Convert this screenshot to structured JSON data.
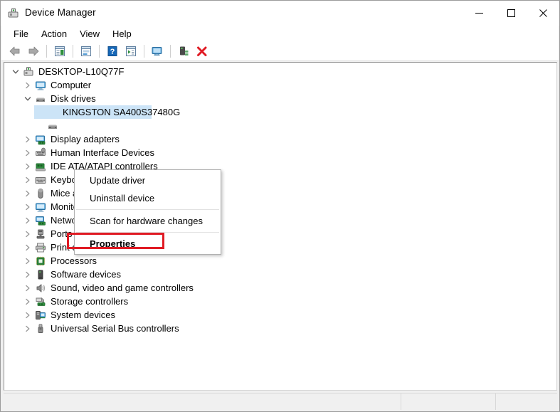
{
  "window": {
    "title": "Device Manager",
    "icon": "device-manager-icon",
    "controls": {
      "minimize": "—",
      "maximize": "□",
      "close": "✕"
    }
  },
  "menubar": {
    "items": [
      {
        "label": "File"
      },
      {
        "label": "Action"
      },
      {
        "label": "View"
      },
      {
        "label": "Help"
      }
    ]
  },
  "toolbar": {
    "buttons": [
      {
        "name": "back-icon",
        "title": "Back"
      },
      {
        "name": "forward-icon",
        "title": "Forward"
      },
      {
        "name": "separator",
        "title": ""
      },
      {
        "name": "show-hide-console-tree-icon",
        "title": "Show/Hide Console Tree"
      },
      {
        "name": "separator",
        "title": ""
      },
      {
        "name": "properties-icon",
        "title": "Properties"
      },
      {
        "name": "separator",
        "title": ""
      },
      {
        "name": "help-icon",
        "title": "Help"
      },
      {
        "name": "update-driver-icon",
        "title": "Update Driver Software"
      },
      {
        "name": "separator",
        "title": ""
      },
      {
        "name": "scan-for-hardware-changes-icon",
        "title": "Scan for hardware changes"
      },
      {
        "name": "separator",
        "title": ""
      },
      {
        "name": "enable-device-icon",
        "title": "Enable device"
      },
      {
        "name": "uninstall-device-icon",
        "title": "Uninstall device"
      }
    ]
  },
  "tree": {
    "nodes": [
      {
        "label": "DESKTOP-L10Q77F",
        "indent": 0,
        "state": "expanded",
        "icon": "computer-node-icon",
        "selected": false
      },
      {
        "label": "Computer",
        "indent": 1,
        "state": "collapsed",
        "icon": "monitor-icon",
        "selected": false
      },
      {
        "label": "Disk drives",
        "indent": 1,
        "state": "expanded",
        "icon": "disk-drive-icon",
        "selected": false
      },
      {
        "label": "KINGSTON SA400S37480G",
        "indent": 2,
        "state": "leaf",
        "icon": "disk-drive-icon",
        "selected": true
      },
      {
        "label": "",
        "indent": 2,
        "state": "leaf",
        "icon": "disk-drive-icon",
        "selected": false
      },
      {
        "label": "Display adapters",
        "indent": 1,
        "state": "collapsed",
        "icon": "display-adapter-icon",
        "selected": false
      },
      {
        "label": "Human Interface Devices",
        "indent": 1,
        "state": "collapsed",
        "icon": "human-interface-device-icon",
        "selected": false
      },
      {
        "label": "IDE ATA/ATAPI controllers",
        "indent": 1,
        "state": "collapsed",
        "icon": "ide-controller-icon",
        "selected": false
      },
      {
        "label": "Keyboards",
        "indent": 1,
        "state": "collapsed",
        "icon": "keyboard-icon",
        "selected": false
      },
      {
        "label": "Mice and other pointing devices",
        "indent": 1,
        "state": "collapsed",
        "icon": "mouse-icon",
        "selected": false
      },
      {
        "label": "Monitors",
        "indent": 1,
        "state": "collapsed",
        "icon": "monitor-icon",
        "selected": false
      },
      {
        "label": "Network adapters",
        "indent": 1,
        "state": "collapsed",
        "icon": "network-adapter-icon",
        "selected": false
      },
      {
        "label": "Ports (COM & LPT)",
        "indent": 1,
        "state": "collapsed",
        "icon": "port-icon",
        "selected": false
      },
      {
        "label": "Print queues",
        "indent": 1,
        "state": "collapsed",
        "icon": "printer-icon",
        "selected": false
      },
      {
        "label": "Processors",
        "indent": 1,
        "state": "collapsed",
        "icon": "processor-icon",
        "selected": false
      },
      {
        "label": "Software devices",
        "indent": 1,
        "state": "collapsed",
        "icon": "software-device-icon",
        "selected": false
      },
      {
        "label": "Sound, video and game controllers",
        "indent": 1,
        "state": "collapsed",
        "icon": "sound-controller-icon",
        "selected": false
      },
      {
        "label": "Storage controllers",
        "indent": 1,
        "state": "collapsed",
        "icon": "storage-controller-icon",
        "selected": false
      },
      {
        "label": "System devices",
        "indent": 1,
        "state": "collapsed",
        "icon": "system-device-icon",
        "selected": false
      },
      {
        "label": "Universal Serial Bus controllers",
        "indent": 1,
        "state": "collapsed",
        "icon": "usb-controller-icon",
        "selected": false
      }
    ]
  },
  "context_menu": {
    "items": [
      {
        "label": "Update driver",
        "type": "item",
        "bold": false,
        "highlighted": false
      },
      {
        "label": "Uninstall device",
        "type": "item",
        "bold": false,
        "highlighted": false
      },
      {
        "label": "",
        "type": "separator",
        "bold": false,
        "highlighted": false
      },
      {
        "label": "Scan for hardware changes",
        "type": "item",
        "bold": false,
        "highlighted": false
      },
      {
        "label": "",
        "type": "separator",
        "bold": false,
        "highlighted": false
      },
      {
        "label": "Properties",
        "type": "item",
        "bold": true,
        "highlighted": true
      }
    ]
  },
  "statusbar": {
    "panels": [
      "",
      "",
      ""
    ]
  },
  "colors": {
    "selection": "#cce4f7",
    "annotation_red": "#e01b24",
    "window_chrome": "#ffffff",
    "status_bg": "#f0f0f0"
  }
}
